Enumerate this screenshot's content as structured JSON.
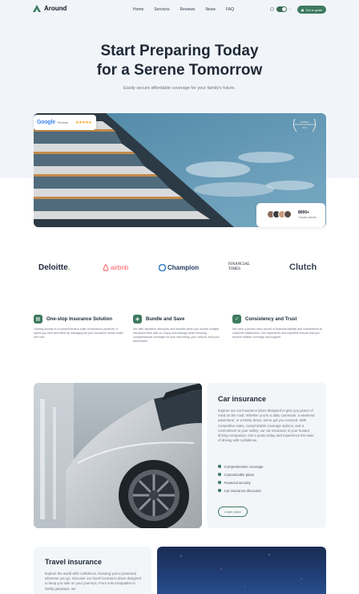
{
  "brand": {
    "name": "Around"
  },
  "nav": {
    "items": [
      "Home",
      "Services",
      "Reviews",
      "News",
      "FAQ"
    ]
  },
  "header": {
    "cta_label": "Get a quote"
  },
  "hero": {
    "title_line1": "Start Preparing Today",
    "title_line2": "for a Serene Tomorrow",
    "subtitle": "Easily secure affordable coverage for your family's future."
  },
  "google_badge": {
    "word": "Google",
    "reviews_label": "Reviews",
    "stars": "★★★★★"
  },
  "award": {
    "line1": "WINNER",
    "line2": "INSURANCE AWARDS",
    "line3": "2024"
  },
  "clients": {
    "count": "8000+",
    "label": "Trusted clients"
  },
  "logos": [
    "Deloitte",
    "airbnb",
    "Champion",
    "FINANCIAL",
    "TIMES",
    "Clutch"
  ],
  "features": [
    {
      "title": "One-stop Insurance Solution",
      "text": "Gaining access to a comprehensive suite of insurance products. It saves you time and effort by managing all your insurance needs under one roof."
    },
    {
      "title": "Bundle and Save",
      "text": "We offer attractive discounts and benefits when you bundle multiple insurance lines with us. Enjoy cost savings while ensuring comprehensive coverage for your well-being, your vehicle, and your adventures."
    },
    {
      "title": "Consistency and Trust",
      "text": "We have a proven track record of financial stability and commitment to customer satisfaction. Our experience and expertise ensure that you receive reliable coverage and support."
    }
  ],
  "car": {
    "title": "Car insurance",
    "text": "Explore our car insurance plans designed to give you peace of mind on the road. Whether you're a daily commuter, a weekend adventurer, or a family driver, we've got you covered. With competitive rates, customizable coverage options, and a commitment to your safety, our car insurance is your trusted driving companion. Get a quote today and experience the ease of driving with confidence.",
    "list": [
      "Comprehensive coverage",
      "Customizable plans",
      "Financial security",
      "Car insurance discounts"
    ],
    "button": "Learn more"
  },
  "travel": {
    "title": "Travel insurance",
    "text": "Explore the world with confidence, knowing you're protected wherever you go. Discover our travel insurance plans designed to keep you safe on your journeys. From solo escapades to family getaways, we"
  },
  "colors": {
    "accent": "#3d7a5f",
    "hero_bg": "#f1f5f9",
    "card_bg": "#f3f6f9"
  }
}
